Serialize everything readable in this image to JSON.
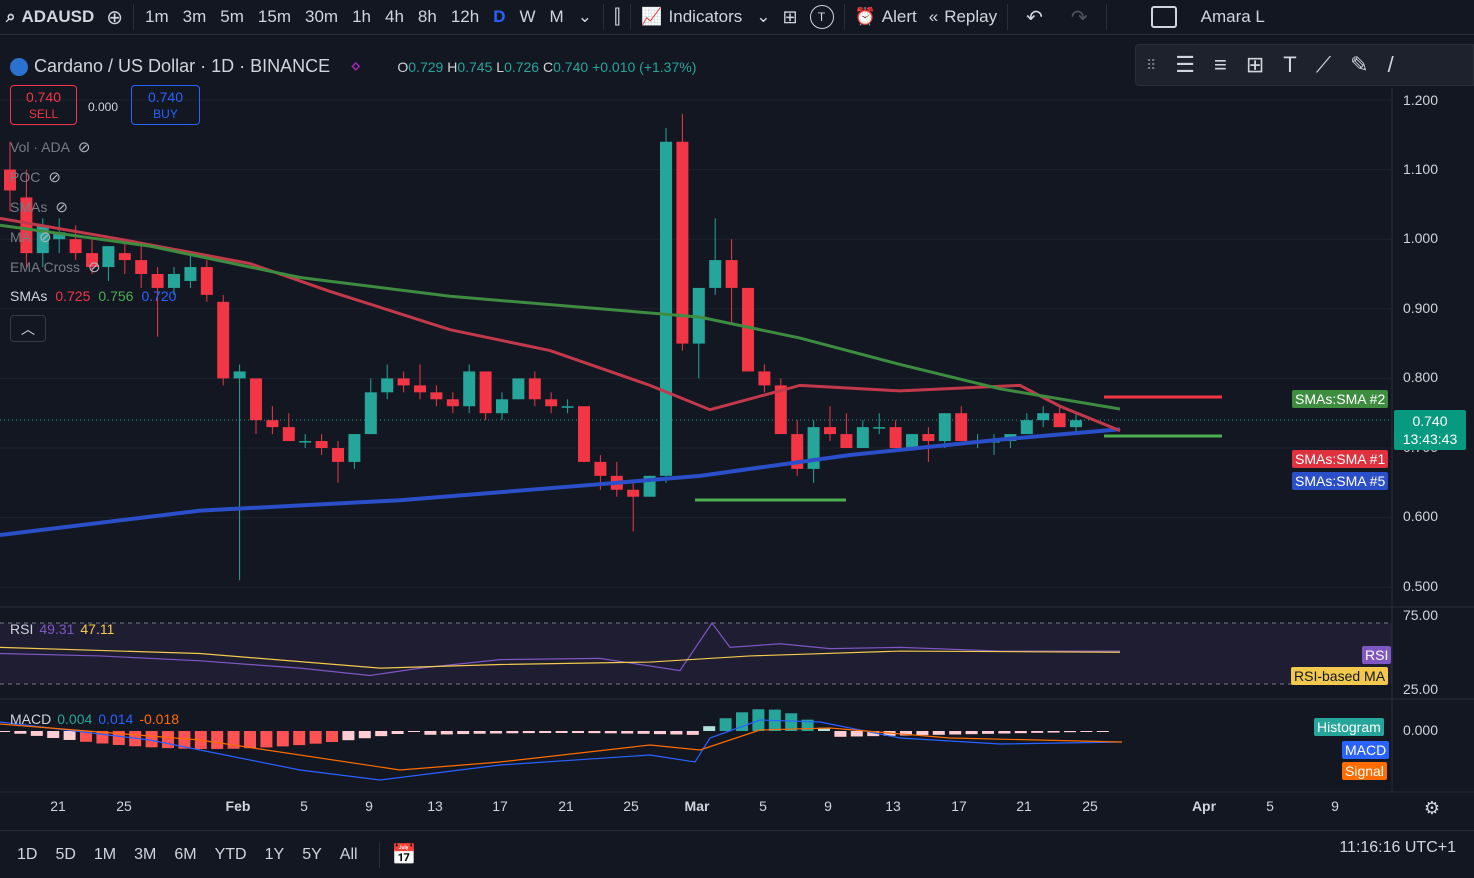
{
  "header": {
    "symbol": "ADAUSD",
    "timeframes": [
      "1m",
      "3m",
      "5m",
      "15m",
      "30m",
      "1h",
      "4h",
      "8h",
      "12h",
      "D",
      "W",
      "M"
    ],
    "active_timeframe": "D",
    "indicators_label": "Indicators",
    "alert_label": "Alert",
    "replay_label": "Replay",
    "user_label": "Amara L"
  },
  "legend": {
    "title": "Cardano / US Dollar · 1D · BINANCE",
    "o_label": "O",
    "o": "0.729",
    "h_label": "H",
    "h": "0.745",
    "l_label": "L",
    "l": "0.726",
    "c_label": "C",
    "c": "0.740",
    "change": "+0.010 (+1.37%)"
  },
  "trade": {
    "sell_price": "0.740",
    "sell_label": "SELL",
    "spread": "0.000",
    "buy_price": "0.740",
    "buy_label": "BUY"
  },
  "indicators": {
    "vol": "Vol · ADA",
    "poc": "POC",
    "smas_hidden": "SMAs",
    "ma": "MA",
    "ema_cross": "EMA Cross",
    "smas_label": "SMAs",
    "sma_v1": "0.725",
    "sma_v2": "0.756",
    "sma_v3": "0.720"
  },
  "price_axis": [
    "1.200",
    "1.100",
    "1.000",
    "0.900",
    "0.800",
    "0.700",
    "0.600",
    "0.500"
  ],
  "price_tags": {
    "sma2": "SMAs:SMA #2",
    "sma1": "SMAs:SMA #1",
    "sma5": "SMAs:SMA #5",
    "current": "0.740",
    "countdown": "13:43:43"
  },
  "rsi": {
    "label": "RSI",
    "value": "49.31",
    "ma_value": "47.11",
    "tag_rsi": "RSI",
    "tag_ma": "RSI-based MA",
    "axis_top": "75.00",
    "axis_bottom": "25.00"
  },
  "macd": {
    "label": "MACD",
    "v1": "0.004",
    "v2": "0.014",
    "v3": "-0.018",
    "tag_hist": "Histogram",
    "tag_macd": "MACD",
    "tag_signal": "Signal",
    "axis_zero": "0.000"
  },
  "time_axis": [
    "21",
    "25",
    "Feb",
    "5",
    "9",
    "13",
    "17",
    "21",
    "25",
    "Mar",
    "5",
    "9",
    "13",
    "17",
    "21",
    "25",
    "Apr",
    "5",
    "9"
  ],
  "ranges": [
    "1D",
    "5D",
    "1M",
    "3M",
    "6M",
    "YTD",
    "1Y",
    "5Y",
    "All"
  ],
  "clock": "11:16:16 UTC+1",
  "colors": {
    "bg": "#131722",
    "up": "#26a69a",
    "down": "#f23645",
    "sma1": "#c23a4a",
    "sma2": "#3d8c40",
    "sma5": "#2a4fc9",
    "rsi": "#7e57c2",
    "rsi_ma": "#f2c94c",
    "macd": "#2962ff",
    "signal": "#ff6d00"
  }
}
